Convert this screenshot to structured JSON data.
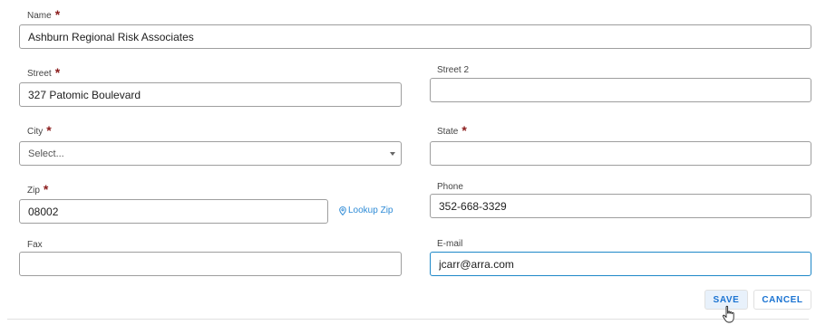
{
  "form": {
    "name": {
      "label": "Name",
      "value": "Ashburn Regional Risk Associates"
    },
    "street": {
      "label": "Street",
      "value": "327 Patomic Boulevard"
    },
    "street2": {
      "label": "Street 2",
      "value": ""
    },
    "city": {
      "label": "City",
      "placeholder": "Select..."
    },
    "state": {
      "label": "State",
      "value": ""
    },
    "zip": {
      "label": "Zip",
      "value": "08002"
    },
    "lookup_zip": "Lookup Zip",
    "phone": {
      "label": "Phone",
      "value": "352-668-3329"
    },
    "fax": {
      "label": "Fax",
      "value": ""
    },
    "email": {
      "label": "E-mail",
      "value": "jcarr@arra.com"
    },
    "required_marker": "*"
  },
  "actions": {
    "save": "SAVE",
    "cancel": "CANCEL"
  },
  "colors": {
    "required": "#8b1c1c",
    "accent": "#1a73d2",
    "link": "#2e8bd6",
    "focus_border": "#1e88c8"
  }
}
